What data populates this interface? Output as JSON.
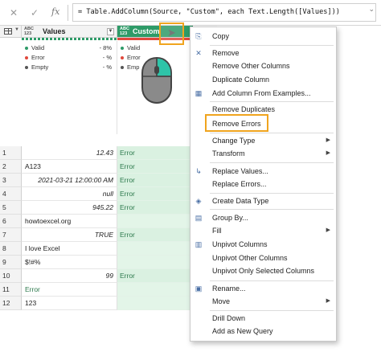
{
  "formula_bar": {
    "cancel_icon": "close-icon",
    "confirm_icon": "check-icon",
    "fx_label": "fx",
    "formula": "= Table.AddColumn(Source, \"Custom\", each Text.Length([Values]))",
    "expand_icon": "chevron-down-icon"
  },
  "columns": [
    {
      "type_label_top": "ABC",
      "type_label_bottom": "123",
      "name": "Values"
    },
    {
      "type_label_top": "ABC",
      "type_label_bottom": "123",
      "name": "Custom"
    }
  ],
  "profile": {
    "values": [
      {
        "label": "Valid",
        "pct": "- 8%",
        "color": "#2e9b68"
      },
      {
        "label": "Error",
        "pct": "- %",
        "color": "#e0483c"
      },
      {
        "label": "Empty",
        "pct": "- %",
        "color": "#555555"
      }
    ],
    "custom": [
      {
        "label": "Valid",
        "color": "#2e9b68"
      },
      {
        "label": "Error",
        "color": "#e0483c"
      },
      {
        "label": "Emp",
        "color": "#555555"
      }
    ]
  },
  "rows": [
    {
      "n": "1",
      "value": "12.43",
      "align": "right",
      "custom": "Error"
    },
    {
      "n": "2",
      "value": "A123",
      "align": "left",
      "custom": "Error"
    },
    {
      "n": "3",
      "value": "2021-03-21 12:00:00 AM",
      "align": "right",
      "custom": "Error"
    },
    {
      "n": "4",
      "value": "null",
      "align": "right",
      "custom": "Error"
    },
    {
      "n": "5",
      "value": "945.22",
      "align": "right",
      "custom": "Error"
    },
    {
      "n": "6",
      "value": "howtoexcel.org",
      "align": "left",
      "custom": ""
    },
    {
      "n": "7",
      "value": "TRUE",
      "align": "right",
      "custom": "Error"
    },
    {
      "n": "8",
      "value": "I love Excel",
      "align": "left",
      "custom": ""
    },
    {
      "n": "9",
      "value": "$!#%",
      "align": "left",
      "custom": ""
    },
    {
      "n": "10",
      "value": "99",
      "align": "right",
      "custom": "Error"
    },
    {
      "n": "11",
      "value": "Error",
      "align": "left",
      "custom": ""
    },
    {
      "n": "12",
      "value": "123",
      "align": "left",
      "custom": ""
    }
  ],
  "menu": {
    "items": [
      {
        "label": "Copy",
        "icon": "copy-icon",
        "glyph": "⎘",
        "sub": false
      },
      {
        "label": "Remove",
        "icon": "remove-column-icon",
        "glyph": "✕",
        "sub": false
      },
      {
        "label": "Remove Other Columns",
        "icon": "",
        "glyph": "",
        "sub": false
      },
      {
        "label": "Duplicate Column",
        "icon": "",
        "glyph": "",
        "sub": false
      },
      {
        "label": "Add Column From Examples...",
        "icon": "add-column-examples-icon",
        "glyph": "▦",
        "sub": false
      },
      {
        "label": "Remove Duplicates",
        "icon": "",
        "glyph": "",
        "sub": false
      },
      {
        "label": "Remove Errors",
        "icon": "",
        "glyph": "",
        "sub": false
      },
      {
        "label": "Change Type",
        "icon": "",
        "glyph": "",
        "sub": true
      },
      {
        "label": "Transform",
        "icon": "",
        "glyph": "",
        "sub": true
      },
      {
        "label": "Replace Values...",
        "icon": "replace-values-icon",
        "glyph": "↳",
        "sub": false
      },
      {
        "label": "Replace Errors...",
        "icon": "",
        "glyph": "",
        "sub": false
      },
      {
        "label": "Create Data Type",
        "icon": "data-type-icon",
        "glyph": "◈",
        "sub": false
      },
      {
        "label": "Group By...",
        "icon": "group-by-icon",
        "glyph": "▤",
        "sub": false
      },
      {
        "label": "Fill",
        "icon": "",
        "glyph": "",
        "sub": true
      },
      {
        "label": "Unpivot Columns",
        "icon": "unpivot-icon",
        "glyph": "▥",
        "sub": false
      },
      {
        "label": "Unpivot Other Columns",
        "icon": "",
        "glyph": "",
        "sub": false
      },
      {
        "label": "Unpivot Only Selected Columns",
        "icon": "",
        "glyph": "",
        "sub": false
      },
      {
        "label": "Rename...",
        "icon": "rename-icon",
        "glyph": "▣",
        "sub": false
      },
      {
        "label": "Move",
        "icon": "",
        "glyph": "",
        "sub": true
      },
      {
        "label": "Drill Down",
        "icon": "",
        "glyph": "",
        "sub": false
      },
      {
        "label": "Add as New Query",
        "icon": "",
        "glyph": "",
        "sub": false
      }
    ]
  },
  "colors": {
    "accent_green": "#2e9b68",
    "error_cell_bg": "#daf1e1",
    "highlight_orange": "#f0a41e"
  }
}
